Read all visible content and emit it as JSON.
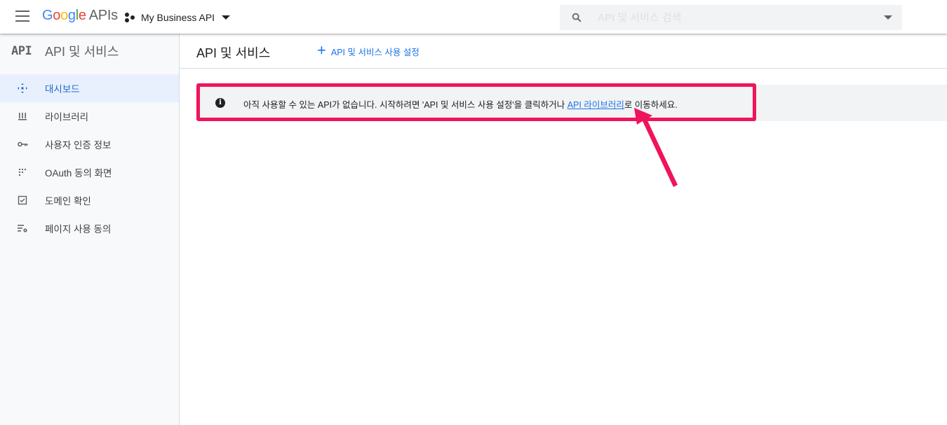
{
  "header": {
    "logo_letters": [
      "G",
      "o",
      "o",
      "g",
      "l",
      "e"
    ],
    "logo_suffix": "APIs",
    "project_name": "My Business API",
    "search_placeholder": "API 및 서비스 검색"
  },
  "sidebar": {
    "mark": "API",
    "title": "API 및 서비스",
    "items": [
      {
        "label": "대시보드",
        "icon": "dashboard-icon",
        "active": true
      },
      {
        "label": "라이브러리",
        "icon": "library-icon",
        "active": false
      },
      {
        "label": "사용자 인증 정보",
        "icon": "key-icon",
        "active": false
      },
      {
        "label": "OAuth 동의 화면",
        "icon": "consent-screen-icon",
        "active": false
      },
      {
        "label": "도메인 확인",
        "icon": "domain-check-icon",
        "active": false
      },
      {
        "label": "페이지 사용 동의",
        "icon": "page-agreement-icon",
        "active": false
      }
    ]
  },
  "main": {
    "title": "API 및 서비스",
    "enable_button_label": "API 및 서비스 사용 설정",
    "notice": {
      "text_before": "아직 사용할 수 있는 API가 없습니다. 시작하려면 'API 및 서비스 사용 설정'을 클릭하거나 ",
      "link_text": "API 라이브러리",
      "text_after": "로 이동하세요."
    }
  },
  "colors": {
    "accent": "#1a73e8",
    "highlight": "#f0145a",
    "active_bg": "#e8f0fe"
  }
}
